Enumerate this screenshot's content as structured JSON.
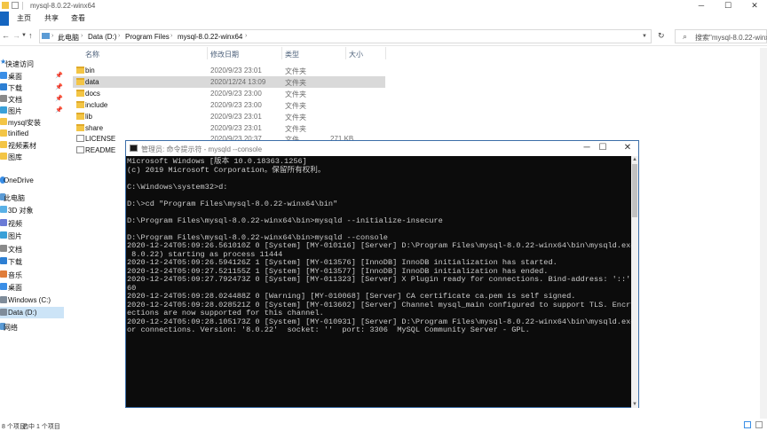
{
  "explorer": {
    "title": "mysql-8.0.22-winx64",
    "ribbon_tabs": [
      "主页",
      "共享",
      "查看"
    ],
    "breadcrumb": [
      "此电脑",
      "Data (D:)",
      "Program Files",
      "mysql-8.0.22-winx64"
    ],
    "search_placeholder": "搜索\"mysql-8.0.22-winx",
    "columns": {
      "name": "名称",
      "modified": "修改日期",
      "type": "类型",
      "size": "大小"
    },
    "files": [
      {
        "name": "bin",
        "modified": "2020/9/23 23:01",
        "type": "文件夹",
        "size": "",
        "kind": "folder"
      },
      {
        "name": "data",
        "modified": "2020/12/24 13:09",
        "type": "文件夹",
        "size": "",
        "kind": "folder"
      },
      {
        "name": "docs",
        "modified": "2020/9/23 23:00",
        "type": "文件夹",
        "size": "",
        "kind": "folder"
      },
      {
        "name": "include",
        "modified": "2020/9/23 23:00",
        "type": "文件夹",
        "size": "",
        "kind": "folder"
      },
      {
        "name": "lib",
        "modified": "2020/9/23 23:01",
        "type": "文件夹",
        "size": "",
        "kind": "folder"
      },
      {
        "name": "share",
        "modified": "2020/9/23 23:01",
        "type": "文件夹",
        "size": "",
        "kind": "folder"
      },
      {
        "name": "LICENSE",
        "modified": "2020/9/23 20:37",
        "type": "文件",
        "size": "271 KB",
        "kind": "file"
      },
      {
        "name": "README",
        "modified": "",
        "type": "",
        "size": "",
        "kind": "file"
      }
    ],
    "nav": {
      "quick_access": "快速访问",
      "items": [
        {
          "label": "桌面",
          "pinned": true,
          "color": "#3a8ee6"
        },
        {
          "label": "下载",
          "pinned": true,
          "color": "#2d7fd3"
        },
        {
          "label": "文档",
          "pinned": true,
          "color": "#8a8a8a"
        },
        {
          "label": "图片",
          "pinned": true,
          "color": "#3aa0d8"
        },
        {
          "label": "mysql安装",
          "pinned": false,
          "color": "#f3c546"
        },
        {
          "label": "tinified",
          "pinned": false,
          "color": "#f3c546"
        },
        {
          "label": "视频素材",
          "pinned": false,
          "color": "#f3c546"
        },
        {
          "label": "图库",
          "pinned": false,
          "color": "#f3c546"
        }
      ],
      "onedrive": "OneDrive",
      "this_pc": "此电脑",
      "pc_items": [
        {
          "label": "3D 对象",
          "color": "#5ab1e6"
        },
        {
          "label": "视频",
          "color": "#6b7bd6"
        },
        {
          "label": "图片",
          "color": "#3aa0d8"
        },
        {
          "label": "文档",
          "color": "#8a8a8a"
        },
        {
          "label": "下载",
          "color": "#2d7fd3"
        },
        {
          "label": "音乐",
          "color": "#e07d3a"
        },
        {
          "label": "桌面",
          "color": "#3a8ee6"
        },
        {
          "label": "Windows (C:)",
          "color": "#7f8c9a"
        },
        {
          "label": "Data (D:)",
          "color": "#7f8c9a"
        }
      ],
      "network": "网络"
    },
    "status": {
      "count": "8 个项目",
      "selected": "选中 1 个项目"
    }
  },
  "console": {
    "title": "管理员: 命令提示符 - mysqld --console",
    "lines": [
      "Microsoft Windows [版本 10.0.18363.1256]",
      "(c) 2019 Microsoft Corporation。保留所有权利。",
      "",
      "C:\\Windows\\system32>d:",
      "",
      "D:\\>cd \"Program Files\\mysql-8.0.22-winx64\\bin\"",
      "",
      "D:\\Program Files\\mysql-8.0.22-winx64\\bin>mysqld --initialize-insecure",
      "",
      "D:\\Program Files\\mysql-8.0.22-winx64\\bin>mysqld --console",
      "2020-12-24T05:09:26.561010Z 0 [System] [MY-010116] [Server] D:\\Program Files\\mysql-8.0.22-winx64\\bin\\mysqld.exe (mysqld 8.0.22) starting as process 11444",
      "2020-12-24T05:09:26.594126Z 1 [System] [MY-013576] [InnoDB] InnoDB initialization has started.",
      "2020-12-24T05:09:27.521155Z 1 [System] [MY-013577] [InnoDB] InnoDB initialization has ended.",
      "2020-12-24T05:09:27.792473Z 0 [System] [MY-011323] [Server] X Plugin ready for connections. Bind-address: '::' port: 33060",
      "2020-12-24T05:09:28.024488Z 0 [Warning] [MY-010068] [Server] CA certificate ca.pem is self signed.",
      "2020-12-24T05:09:28.028521Z 0 [System] [MY-013602] [Server] Channel mysql_main configured to support TLS. Encrypted connections are now supported for this channel.",
      "2020-12-24T05:09:28.105173Z 0 [System] [MY-010931] [Server] D:\\Program Files\\mysql-8.0.22-winx64\\bin\\mysqld.exe: ready for connections. Version: '8.0.22'  socket: ''  port: 3306  MySQL Community Server - GPL."
    ],
    "wrapped_display": [
      "Microsoft Windows [版本 10.0.18363.1256]",
      "(c) 2019 Microsoft Corporation。保留所有权利。",
      "",
      "C:\\Windows\\system32>d:",
      "",
      "D:\\>cd \"Program Files\\mysql-8.0.22-winx64\\bin\"",
      "",
      "D:\\Program Files\\mysql-8.0.22-winx64\\bin>mysqld --initialize-insecure",
      "",
      "D:\\Program Files\\mysql-8.0.22-winx64\\bin>mysqld --console",
      "2020-12-24T05:09:26.561010Z 0 [System] [MY-010116] [Server] D:\\Program Files\\mysql-8.0.22-winx64\\bin\\mysqld.exe (mysqld",
      " 8.0.22) starting as process 11444",
      "2020-12-24T05:09:26.594126Z 1 [System] [MY-013576] [InnoDB] InnoDB initialization has started.",
      "2020-12-24T05:09:27.521155Z 1 [System] [MY-013577] [InnoDB] InnoDB initialization has ended.",
      "2020-12-24T05:09:27.792473Z 0 [System] [MY-011323] [Server] X Plugin ready for connections. Bind-address: '::' port: 330",
      "60",
      "2020-12-24T05:09:28.024488Z 0 [Warning] [MY-010068] [Server] CA certificate ca.pem is self signed.",
      "2020-12-24T05:09:28.028521Z 0 [System] [MY-013602] [Server] Channel mysql_main configured to support TLS. Encrypted conn",
      "ections are now supported for this channel.",
      "2020-12-24T05:09:28.105173Z 0 [System] [MY-010931] [Server] D:\\Program Files\\mysql-8.0.22-winx64\\bin\\mysqld.exe: ready f",
      "or connections. Version: '8.0.22'  socket: ''  port: 3306  MySQL Community Server - GPL."
    ]
  }
}
